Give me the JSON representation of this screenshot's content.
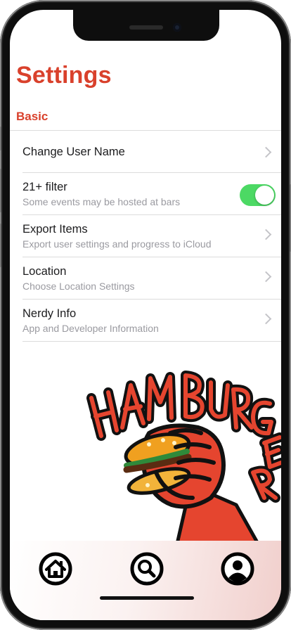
{
  "page": {
    "title": "Settings"
  },
  "sections": [
    {
      "header": "Basic",
      "rows": [
        {
          "title": "Change User Name",
          "subtitle": "",
          "accessory": "chevron"
        },
        {
          "title": "21+ filter",
          "subtitle": "Some events may be hosted at bars",
          "accessory": "toggle",
          "toggle_on": true
        },
        {
          "title": "Export Items",
          "subtitle": "Export user settings and progress to iCloud",
          "accessory": "chevron"
        },
        {
          "title": "Location",
          "subtitle": "Choose Location Settings",
          "accessory": "chevron"
        },
        {
          "title": "Nerdy Info",
          "subtitle": "App and Developer Information",
          "accessory": "chevron"
        }
      ]
    }
  ],
  "mascot": {
    "wordmark": "HAM BURGER",
    "icon": "fist-holding-burger"
  },
  "tabbar": {
    "items": [
      {
        "icon": "home-icon"
      },
      {
        "icon": "search-icon"
      },
      {
        "icon": "profile-icon"
      }
    ]
  },
  "colors": {
    "accent": "#d9412c",
    "toggle_on": "#4cd964",
    "text_primary": "#1c1c1e",
    "text_secondary": "#9a9aa0",
    "separator": "#dcdcdc"
  }
}
